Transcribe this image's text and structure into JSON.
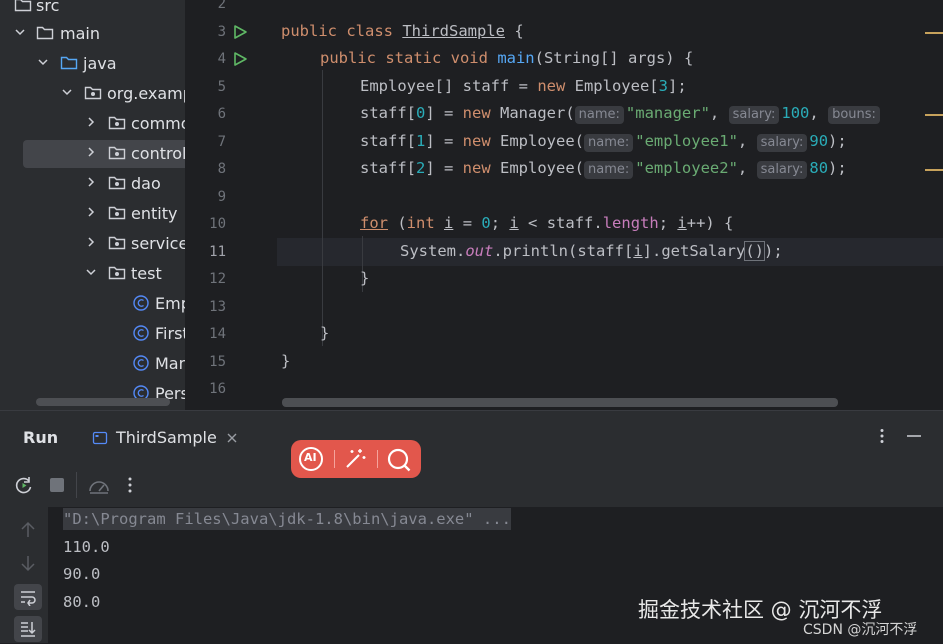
{
  "project_tree": {
    "items": [
      {
        "label": "src",
        "icon": "folder-icon"
      },
      {
        "label": "main",
        "icon": "folder-icon"
      },
      {
        "label": "java",
        "icon": "source-folder-icon"
      },
      {
        "label": "org.examp",
        "icon": "package-icon"
      },
      {
        "label": "commo",
        "icon": "package-icon"
      },
      {
        "label": "control",
        "icon": "package-icon"
      },
      {
        "label": "dao",
        "icon": "package-icon"
      },
      {
        "label": "entity",
        "icon": "package-icon"
      },
      {
        "label": "service",
        "icon": "package-icon"
      },
      {
        "label": "test",
        "icon": "package-icon"
      },
      {
        "label": "Emp",
        "icon": "class-icon"
      },
      {
        "label": "First",
        "icon": "class-icon"
      },
      {
        "label": "Man",
        "icon": "class-icon"
      },
      {
        "label": "Pers",
        "icon": "class-icon"
      }
    ]
  },
  "editor": {
    "line_numbers": [
      "2",
      "3",
      "4",
      "5",
      "6",
      "7",
      "8",
      "9",
      "10",
      "11",
      "12",
      "13",
      "14",
      "15",
      "16"
    ],
    "current_line": "11",
    "code": {
      "l3_kw": "public class ",
      "l3_name": "ThirdSample",
      "l3_end": " {",
      "l4_kw": "public static void ",
      "l4_fn": "main",
      "l4_rest": "(String[] args) {",
      "l5_a": "Employee[] staff = ",
      "l5_new": "new",
      "l5_b": " Employee[",
      "l5_num": "3",
      "l5_c": "];",
      "l6_a": "staff[",
      "l6_i": "0",
      "l6_b": "] = ",
      "l6_new": "new",
      "l6_c": " Manager(",
      "l6_h1": "name:",
      "l6_s1": "\"manager\"",
      "l6_comma1": ", ",
      "l6_h2": "salary:",
      "l6_n2": "100",
      "l6_comma2": ", ",
      "l6_h3": "bouns:",
      "l7_a": "staff[",
      "l7_i": "1",
      "l7_b": "] = ",
      "l7_new": "new",
      "l7_c": " Employee(",
      "l7_h1": "name:",
      "l7_s1": "\"employee1\"",
      "l7_comma": ", ",
      "l7_h2": "salary:",
      "l7_n2": "90",
      "l7_end": ");",
      "l8_a": "staff[",
      "l8_i": "2",
      "l8_b": "] = ",
      "l8_new": "new",
      "l8_c": " Employee(",
      "l8_h1": "name:",
      "l8_s1": "\"employee2\"",
      "l8_comma": ", ",
      "l8_h2": "salary:",
      "l8_n2": "80",
      "l8_end": ");",
      "l10_for": "for",
      "l10_a": " (",
      "l10_int": "int",
      "l10_b": " ",
      "l10_i1": "i",
      "l10_c": " = ",
      "l10_zero": "0",
      "l10_d": "; ",
      "l10_i2": "i",
      "l10_e": " < staff.",
      "l10_len": "length",
      "l10_f": "; ",
      "l10_i3": "i",
      "l10_g": "++) {",
      "l11_a": "System.",
      "l11_out": "out",
      "l11_b": ".println(staff[",
      "l11_i": "i",
      "l11_c": "].getSalary",
      "l11_paren": "()",
      "l11_d": ");",
      "l12": "}",
      "l14": "}",
      "l15": "}"
    }
  },
  "run_panel": {
    "title": "Run",
    "tab_label": "ThirdSample",
    "command": "\"D:\\Program Files\\Java\\jdk-1.8\\bin\\java.exe\" ...",
    "output": [
      "110.0",
      "90.0",
      "80.0"
    ]
  },
  "overlay": {
    "ai_label": "AI"
  },
  "watermark": {
    "main": "掘金技术社区 @ 沉河不浮",
    "sub": "CSDN @沉河不浮"
  },
  "colors": {
    "keyword": "#cf8e6d",
    "function": "#56a8f5",
    "string": "#6aab73",
    "number": "#2aacb8",
    "field": "#c77dbb",
    "run_green": "#5fb865",
    "ai_toolbar": "#e2574c"
  }
}
